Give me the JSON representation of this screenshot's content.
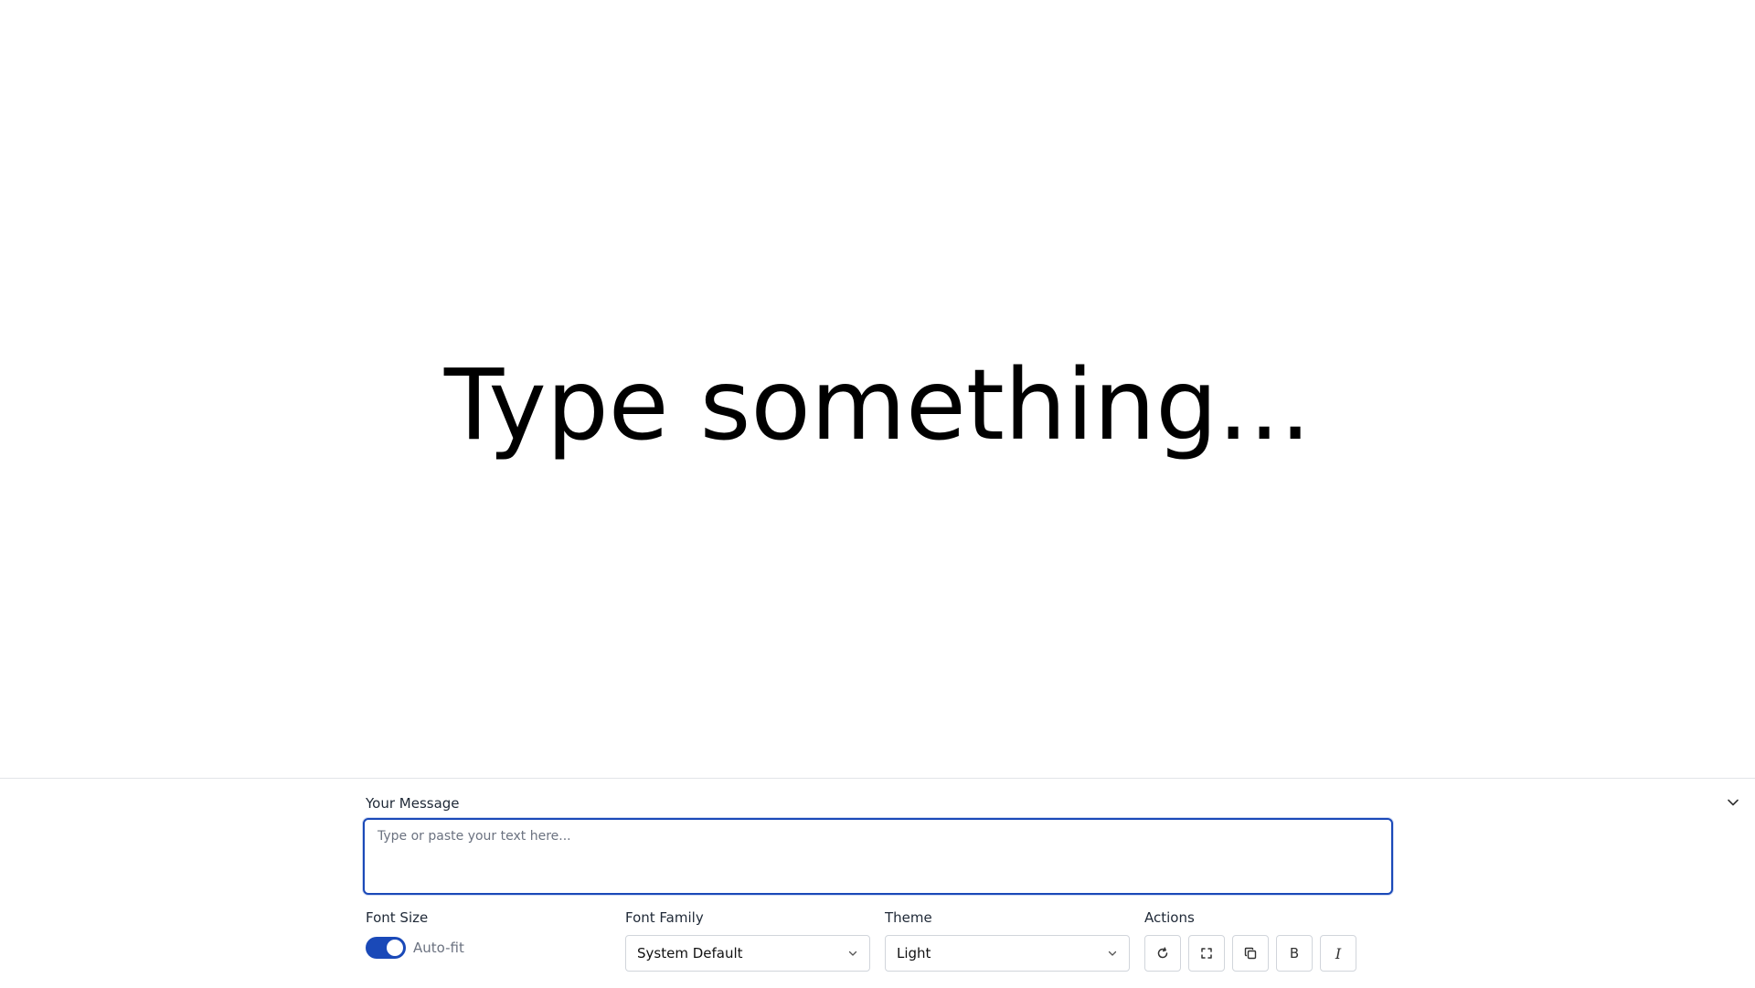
{
  "display": {
    "text": "Type something..."
  },
  "panel": {
    "message_label": "Your Message",
    "message_placeholder": "Type or paste your text here...",
    "message_value": "",
    "collapse_icon": "chevron-down-icon",
    "font_size": {
      "label": "Font Size",
      "autofit_label": "Auto-fit",
      "autofit_enabled": true
    },
    "font_family": {
      "label": "Font Family",
      "selected": "System Default"
    },
    "theme": {
      "label": "Theme",
      "selected": "Light"
    },
    "actions": {
      "label": "Actions",
      "buttons": [
        {
          "icon": "refresh-icon"
        },
        {
          "icon": "fullscreen-icon"
        },
        {
          "icon": "copy-icon"
        },
        {
          "icon": "bold-icon",
          "glyph": "B"
        },
        {
          "icon": "italic-icon",
          "glyph": "I"
        }
      ]
    }
  },
  "colors": {
    "accent": "#1a49b8",
    "border": "#d1d5db",
    "muted_text": "#6b7280"
  }
}
